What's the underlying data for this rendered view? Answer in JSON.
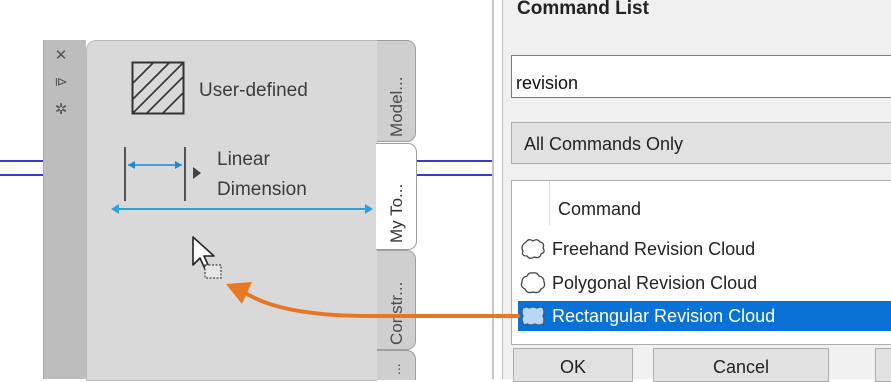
{
  "palette": {
    "tools": [
      {
        "label": "User-defined",
        "icon": "hatch-icon"
      },
      {
        "label_line1": "Linear",
        "label_line2": "Dimension",
        "icon": "linear-dimension-icon"
      }
    ],
    "tabs": [
      "Model...",
      "My To...",
      "Constr...",
      "..."
    ],
    "active_tab": "My To..."
  },
  "dialog": {
    "title": "Command List",
    "search_value": "revision",
    "filter_value": "All Commands Only",
    "column_header": "Command",
    "commands": [
      {
        "label": "Freehand Revision Cloud",
        "icon": "freehand-cloud-icon",
        "selected": false
      },
      {
        "label": "Polygonal Revision Cloud",
        "icon": "polygonal-cloud-icon",
        "selected": false
      },
      {
        "label": "Rectangular Revision Cloud",
        "icon": "rectangular-cloud-icon",
        "selected": true
      }
    ],
    "buttons": {
      "ok": "OK",
      "cancel": "Cancel"
    }
  },
  "colors": {
    "accent": "#0a72d6",
    "arrow": "#e87722",
    "dimension": "#29a3e0",
    "drawing_line": "#3a3acf"
  }
}
